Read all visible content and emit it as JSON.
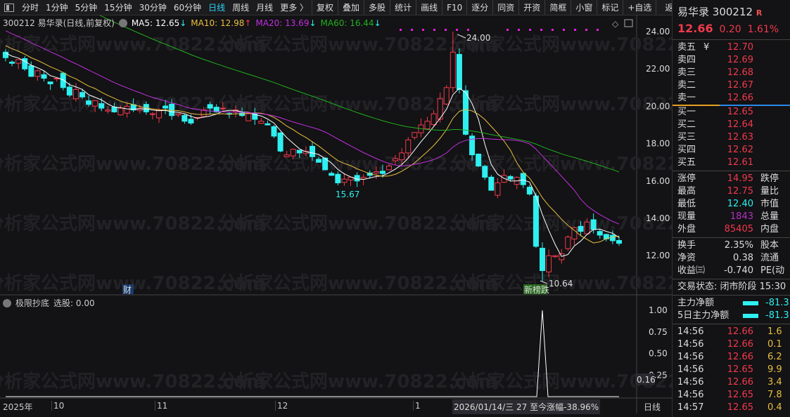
{
  "toolbar": {
    "items": [
      "分时",
      "1分钟",
      "5分钟",
      "15分钟",
      "30分钟",
      "60分钟",
      "日线",
      "周线",
      "月线",
      "更多 〉"
    ],
    "active": "日线",
    "buttons": [
      "复权",
      "叠加",
      "多股",
      "统计",
      "画线",
      "F10",
      "逐分",
      "同资",
      "开资",
      "简框",
      "小窗",
      "标记",
      "+自选",
      "返回"
    ]
  },
  "info": {
    "title": "300212 易华录(日线,前复权)",
    "ma5": "MA5: 12.65",
    "ma10": "MA10: 12.98",
    "ma20": "MA20: 13.69",
    "ma60": "MA60: 16.44",
    "ma5_arrow": "↓",
    "ma10_arrow": "↑",
    "ma20_arrow": "↓",
    "ma60_arrow": "↓"
  },
  "colors": {
    "up": "#f03a4d",
    "down": "#2ef0f0",
    "ma5": "#ffffff",
    "ma10": "#e8c040",
    "ma20": "#c030e0",
    "ma60": "#20b020"
  },
  "watermark": "分析家公式网www.70822.com",
  "chart_data": {
    "type": "candlestick",
    "yaxis": [
      "24.00",
      "22.00",
      "20.00",
      "18.00",
      "16.00",
      "14.00",
      "12.00"
    ],
    "ylim": [
      11,
      24.8
    ],
    "close": [
      22.6,
      22.3,
      22.5,
      22.0,
      21.6,
      21.9,
      21.5,
      21.2,
      21.5,
      21.0,
      20.6,
      20.9,
      20.5,
      20.1,
      20.3,
      19.9,
      19.8,
      19.7,
      19.9,
      20.0,
      19.8,
      19.9,
      19.7,
      19.6,
      19.8,
      19.9,
      19.5,
      19.6,
      19.2,
      19.1,
      19.4,
      19.8,
      19.9,
      19.7,
      19.9,
      19.6,
      19.8,
      19.5,
      19.6,
      19.3,
      19.2,
      19.0,
      18.4,
      17.6,
      17.4,
      17.7,
      17.5,
      17.6,
      17.3,
      17.0,
      16.6,
      16.3,
      15.9,
      16.1,
      16.2,
      16.0,
      16.2,
      16.3,
      16.5,
      16.4,
      16.8,
      17.2,
      17.5,
      18.2,
      18.6,
      19.0,
      19.2,
      19.6,
      20.4,
      21.0,
      22.9,
      20.9,
      18.5,
      17.4,
      16.8,
      16.2,
      15.5,
      15.9,
      16.3,
      16.1,
      16.2,
      15.8,
      15.3,
      12.5,
      11.2,
      12.0,
      12.0,
      12.1,
      13.0,
      13.5,
      13.3,
      13.8,
      13.4,
      13.1,
      12.9,
      12.8,
      12.66
    ],
    "labels": {
      "high": "24.00",
      "low": "10.64",
      "mid_low": "15.67",
      "fin": "财",
      "event": "新榜跌"
    }
  },
  "indicator": {
    "name": "极限抄底",
    "value": "选股: 0.00",
    "yaxis": [
      "1.00",
      "0.75",
      "0.50",
      "0.25"
    ],
    "current": "0.16",
    "signal_index": 84
  },
  "xaxis": {
    "labels": [
      "2025年",
      "10",
      "11",
      "12",
      "1"
    ],
    "status": "2026/01/14/三 27 至今涨幅-38.96%",
    "period": "日线"
  },
  "quote": {
    "name": "易华录",
    "code": "300212",
    "badge": "R",
    "price": "12.66",
    "change": "0.20",
    "pct": "1.61%",
    "asks": [
      [
        "卖五",
        "12.70"
      ],
      [
        "卖四",
        "12.69"
      ],
      [
        "卖三",
        "12.68"
      ],
      [
        "卖二",
        "12.67"
      ],
      [
        "卖一",
        "12.66"
      ]
    ],
    "bids": [
      [
        "买一",
        "12.65"
      ],
      [
        "买二",
        "12.64"
      ],
      [
        "买三",
        "12.63"
      ],
      [
        "买四",
        "12.62"
      ],
      [
        "买五",
        "12.61"
      ]
    ],
    "asks_mark": "¥",
    "stats": [
      [
        "涨停",
        "14.95",
        "跌停"
      ],
      [
        "最高",
        "12.75",
        "量比"
      ],
      [
        "最低",
        "12.40",
        "市值"
      ],
      [
        "现量",
        "1843",
        "总量"
      ],
      [
        "外盘",
        "85405",
        "内盘"
      ]
    ],
    "stats2": [
      [
        "换手",
        "2.35%",
        "股本"
      ],
      [
        "净资",
        "0.38",
        "流通"
      ],
      [
        "收益㈢",
        "-0.740",
        "PE(动"
      ]
    ],
    "trade_status": "交易状态: 闭市阶段 15:30",
    "flows": [
      [
        "主力净额",
        "-81.3"
      ],
      [
        "5日主力净额",
        "-81.3"
      ]
    ],
    "ticks": [
      [
        "14:56",
        "12.66",
        "1.6"
      ],
      [
        "14:56",
        "12.66",
        "0.1"
      ],
      [
        "14:56",
        "12.66",
        "6.2"
      ],
      [
        "14:56",
        "12.65",
        "9.9"
      ],
      [
        "14:56",
        "12.66",
        "3.4"
      ],
      [
        "14:56",
        "12.65",
        "7.8"
      ],
      [
        "14:57",
        "12.65",
        "0.4"
      ]
    ]
  }
}
